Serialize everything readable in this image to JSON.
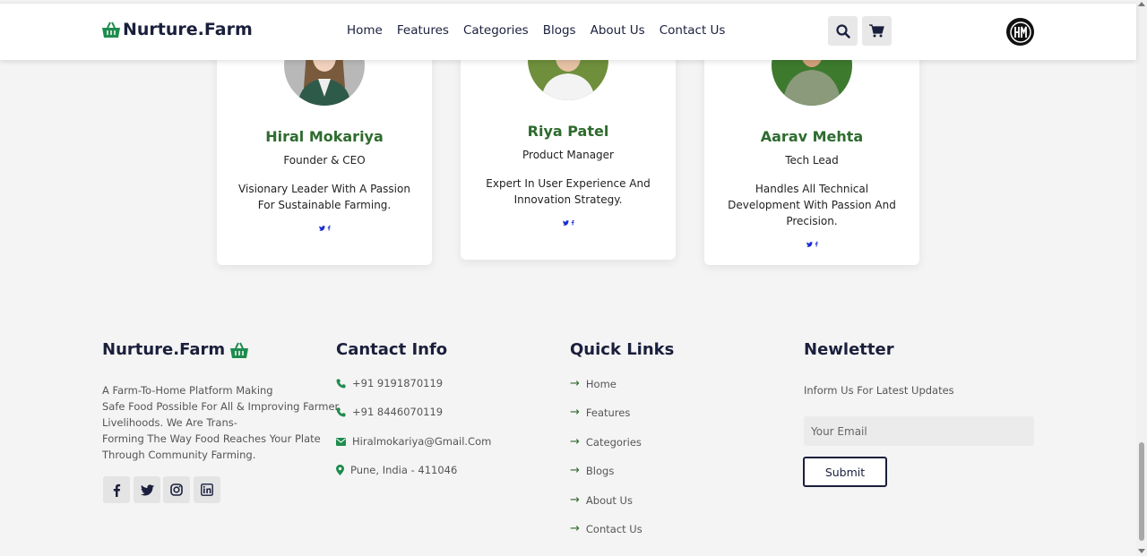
{
  "header": {
    "brand": "Nurture.Farm",
    "nav": [
      "Home",
      "Features",
      "Categories",
      "Blogs",
      "About Us",
      "Contact Us"
    ],
    "search_icon": "search-icon",
    "cart_icon": "cart-icon",
    "avatar_icon": "hm-logo-icon"
  },
  "team": [
    {
      "name": "Hiral Mokariya",
      "role": "Founder & CEO",
      "desc": "Visionary Leader With A Passion For Sustainable Farming.",
      "social": "✔ f"
    },
    {
      "name": "Riya Patel",
      "role": "Product Manager",
      "desc": "Expert In User Experience And Innovation Strategy.",
      "social": "✔ f"
    },
    {
      "name": "Aarav Mehta",
      "role": "Tech Lead",
      "desc": "Handles All Technical Development With Passion And Precision.",
      "social": "✔ f"
    }
  ],
  "footer": {
    "brand": "Nurture.Farm",
    "about": "A Farm-To-Home Platform Making Safe Food Possible For All & Improving Farmer Livelihoods. We Are Trans-Forming The Way Food Reaches Your Plate Through Community Farming.",
    "about_lines": [
      "A Farm-To-Home Platform Making",
      "Safe Food Possible For All & Improving Farmer",
      "Livelihoods. We Are Trans-",
      "Forming The Way Food Reaches Your Plate",
      "Through Community Farming."
    ],
    "contact_title": "Cantact Info",
    "contacts": [
      "+91 9191870119",
      "+91 8446070119",
      "Hiralmokariya@Gmail.Com",
      "Pune, India - 411046"
    ],
    "quick_title": "Quick Links",
    "quick_links": [
      "Home",
      "Features",
      "Categories",
      "Blogs",
      "About Us",
      "Contact Us"
    ],
    "news_title": "Newletter",
    "news_text": "Inform Us For Latest Updates",
    "email_placeholder": "Your Email",
    "submit": "Submit"
  },
  "colors": {
    "brand_green": "#1e8c4e",
    "heading_green": "#2e6b2e",
    "navy": "#1a1f3c"
  }
}
